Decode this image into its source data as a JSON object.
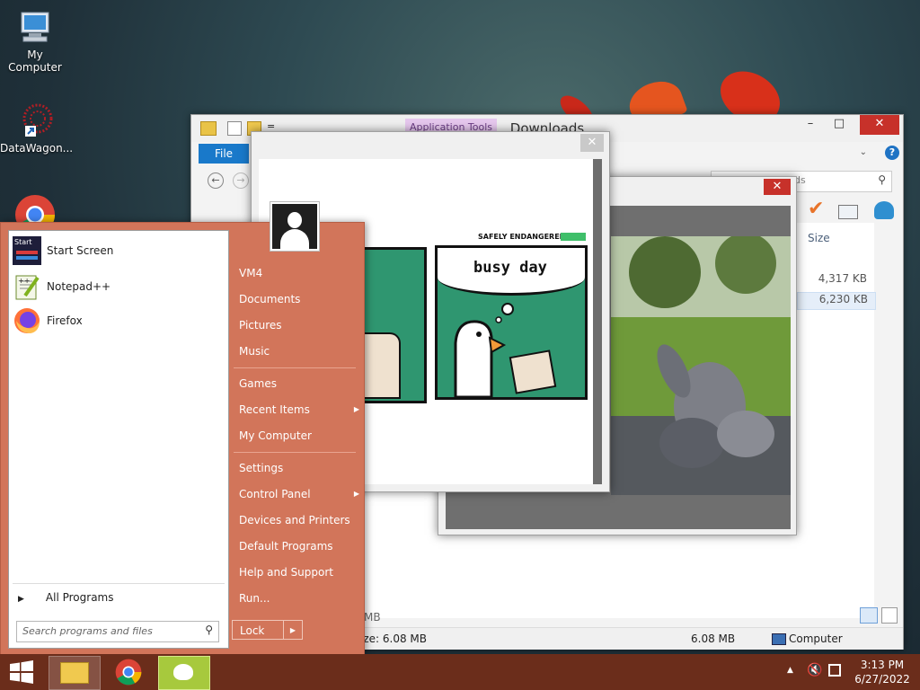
{
  "desktop": {
    "icons": [
      {
        "label": "My Computer"
      },
      {
        "label": "DataWagon..."
      }
    ]
  },
  "explorer": {
    "title": "Downloads",
    "app_tools_label": "Application Tools",
    "file_tab": "File",
    "search_placeholder_fragment": "ds",
    "column_size": "Size",
    "sizes": [
      "4,317 KB",
      "6,230 KB"
    ],
    "status_fragment": "ize: 6.08 MB",
    "status_fragment2": "MB",
    "status_size": "6.08 MB",
    "status_location": "Computer",
    "min_label": "–",
    "max_label": "□",
    "close_label": "✕"
  },
  "viewer": {
    "close_label": "✕",
    "comic": {
      "brand": "SAFELY ENDANGERED",
      "caption": "busy day"
    }
  },
  "start_menu": {
    "programs": [
      {
        "label": "Start Screen",
        "icon": "start-screen-icon"
      },
      {
        "label": "Notepad++",
        "icon": "notepadpp-icon"
      },
      {
        "label": "Firefox",
        "icon": "firefox-icon"
      }
    ],
    "all_programs": "All Programs",
    "search_placeholder": "Search programs and files",
    "right_items": [
      {
        "label": "VM4",
        "arrow": false
      },
      {
        "label": "Documents",
        "arrow": false
      },
      {
        "label": "Pictures",
        "arrow": false
      },
      {
        "label": "Music",
        "arrow": false
      },
      {
        "label": "Games",
        "arrow": false
      },
      {
        "label": "Recent Items",
        "arrow": true
      },
      {
        "label": "My Computer",
        "arrow": false
      },
      {
        "label": "Settings",
        "arrow": false
      },
      {
        "label": "Control Panel",
        "arrow": true
      },
      {
        "label": "Devices and Printers",
        "arrow": false
      },
      {
        "label": "Default Programs",
        "arrow": false
      },
      {
        "label": "Help and Support",
        "arrow": false
      },
      {
        "label": "Run...",
        "arrow": false
      }
    ],
    "lock_label": "Lock"
  },
  "taskbar": {
    "time": "3:13 PM",
    "date": "6/27/2022"
  }
}
